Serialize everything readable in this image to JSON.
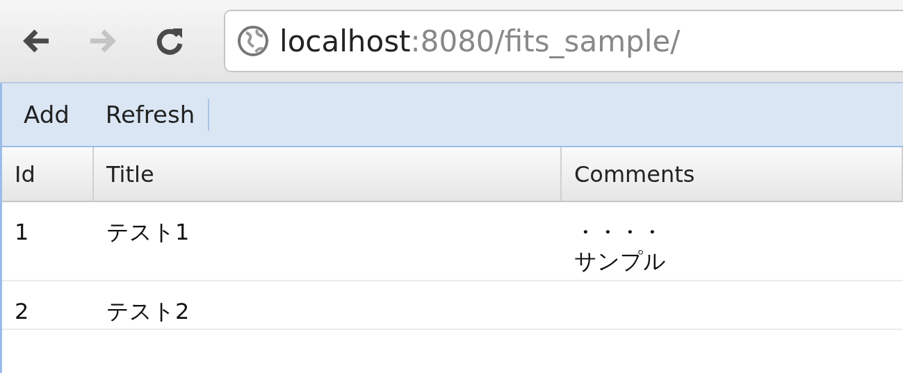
{
  "browser": {
    "nav_buttons": [
      {
        "kind": "back",
        "disabled": false
      },
      {
        "kind": "forward",
        "disabled": true
      },
      {
        "kind": "reload",
        "disabled": false
      }
    ],
    "address": {
      "host": "localhost",
      "rest": ":8080/fits_sample/"
    }
  },
  "toolbar": {
    "buttons": [
      "Add",
      "Refresh"
    ]
  },
  "table": {
    "columns": [
      "Id",
      "Title",
      "Comments"
    ],
    "rows": [
      {
        "id": "1",
        "title": "テスト1",
        "comment_lines": [
          "・・・・",
          "サンプル"
        ]
      },
      {
        "id": "2",
        "title": "テスト2"
      }
    ]
  }
}
